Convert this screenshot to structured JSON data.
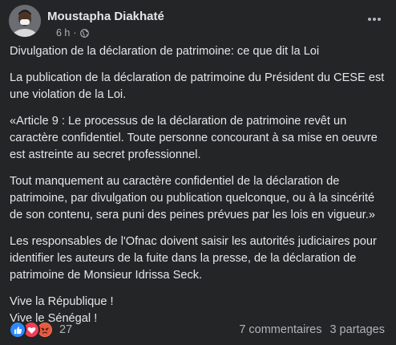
{
  "post": {
    "author": "Moustapha Diakhaté",
    "time": "6 h",
    "separator": "·",
    "privacy_icon": "globe-icon",
    "more_icon": "more-horizontal-icon",
    "paragraphs": [
      "Divulgation de la déclaration de patrimoine: ce que dit la Loi",
      "La publication de la déclaration de patrimoine du Président du CESE est une violation de la Loi.",
      "«Article 9 : Le processus de la déclaration de patrimoine revêt un caractère confidentiel. Toute personne concourant à sa mise en oeuvre est astreinte au secret professionnel.",
      "Tout manquement au caractère confidentiel de la déclaration de patrimoine, par divulgation ou publication quelconque, ou à la sincérité de son contenu, sera puni des peines prévues par les lois en vigueur.»",
      "Les responsables de l'Ofnac doivent saisir les autorités judiciaires pour identifier les auteurs de la fuite dans la presse, de la déclaration de patrimoine de Monsieur Idrissa Seck."
    ],
    "closing_lines": [
      "Vive la République !",
      "Vive le Sénégal !"
    ]
  },
  "footer": {
    "reaction_icons": [
      "like-icon",
      "love-icon",
      "angry-icon"
    ],
    "reaction_count": "27",
    "comments": "7 commentaires",
    "shares": "3 partages"
  },
  "colors": {
    "background": "#242526",
    "text": "#e4e6eb",
    "secondary_text": "#b0b3b8",
    "like": "#2d88ff",
    "love": "#f33e58",
    "angry": "#f7714c"
  }
}
